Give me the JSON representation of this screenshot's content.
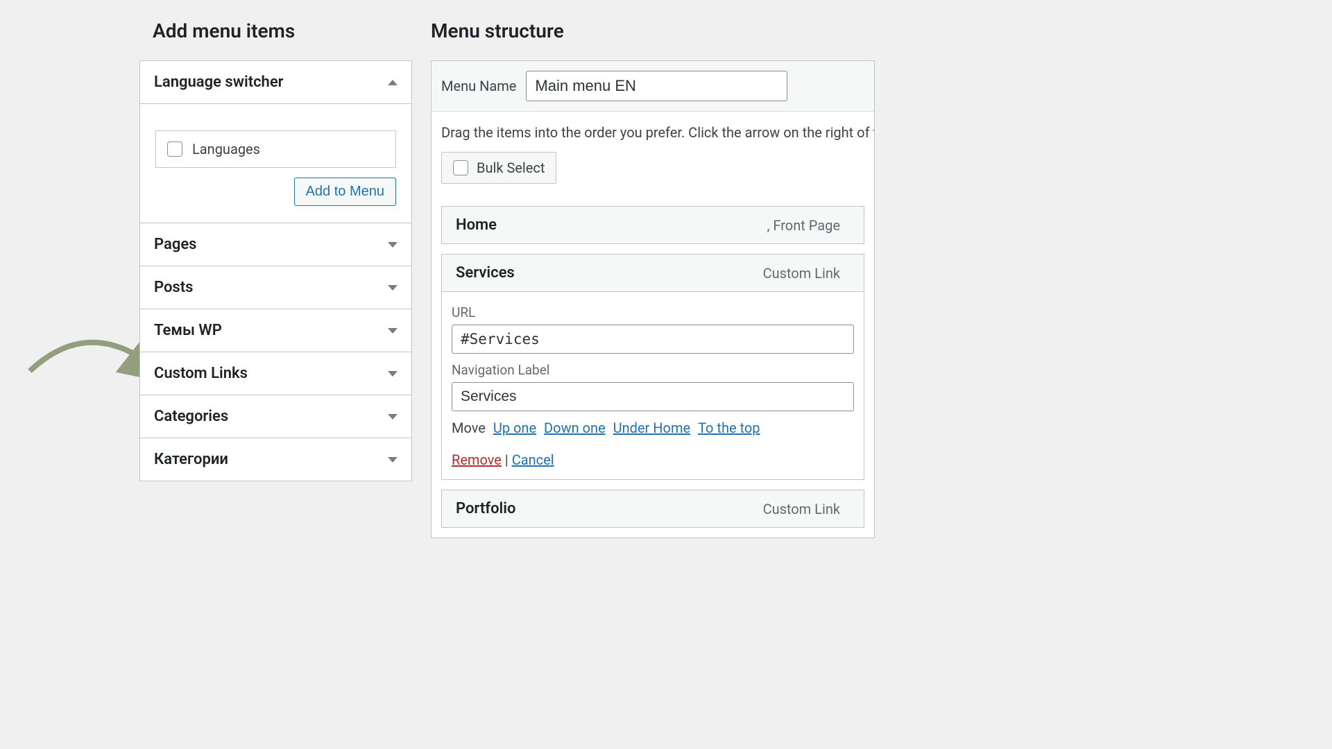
{
  "left": {
    "title": "Add menu items",
    "sections": [
      {
        "label": "Language switcher",
        "expanded": true
      },
      {
        "label": "Pages",
        "expanded": false
      },
      {
        "label": "Posts",
        "expanded": false
      },
      {
        "label": "Темы WP",
        "expanded": false
      },
      {
        "label": "Custom Links",
        "expanded": false
      },
      {
        "label": "Categories",
        "expanded": false
      },
      {
        "label": "Категории",
        "expanded": false
      }
    ],
    "languages_checkbox_label": "Languages",
    "add_to_menu_label": "Add to Menu"
  },
  "right": {
    "title": "Menu structure",
    "menu_name_label": "Menu Name",
    "menu_name_value": "Main menu EN",
    "drag_info": "Drag the items into the order you prefer. Click the arrow on the right of t",
    "bulk_select_label": "Bulk Select",
    "items": [
      {
        "title": "Home",
        "type": ", Front Page",
        "expanded": false
      },
      {
        "title": "Services",
        "type": "Custom Link",
        "expanded": true,
        "url_label": "URL",
        "url_value": "#Services",
        "nav_label": "Navigation Label",
        "nav_value": "Services",
        "move_label": "Move",
        "move_links": [
          "Up one",
          "Down one",
          "Under Home",
          "To the top"
        ],
        "remove_label": "Remove",
        "cancel_label": "Cancel"
      },
      {
        "title": "Portfolio",
        "type": "Custom Link",
        "expanded": false
      }
    ]
  }
}
